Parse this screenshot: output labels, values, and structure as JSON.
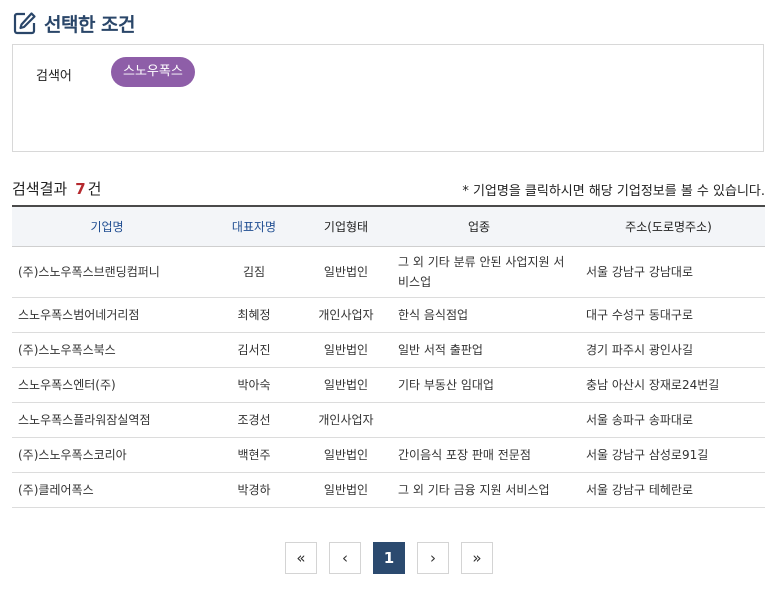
{
  "section": {
    "title": "선택한 조건",
    "icon": "edit-icon"
  },
  "condition": {
    "label": "검색어",
    "keyword": "스노우폭스"
  },
  "results": {
    "label": "검색결과",
    "count": "7",
    "unit": "건",
    "note": "* 기업명을 클릭하시면 해당 기업정보를 볼 수 있습니다."
  },
  "table": {
    "headers": {
      "company": "기업명",
      "ceo": "대표자명",
      "type": "기업형태",
      "industry": "업종",
      "address": "주소(도로명주소)"
    },
    "rows": [
      {
        "company": "(주)스노우폭스브랜딩컴퍼니",
        "ceo": "김짐",
        "type": "일반법인",
        "industry": "그 외 기타 분류 안된 사업지원 서비스업",
        "address": "서울 강남구 강남대로"
      },
      {
        "company": "스노우폭스범어네거리점",
        "ceo": "최혜정",
        "type": "개인사업자",
        "industry": "한식 음식점업",
        "address": "대구 수성구 동대구로"
      },
      {
        "company": "(주)스노우폭스북스",
        "ceo": "김서진",
        "type": "일반법인",
        "industry": "일반 서적 출판업",
        "address": "경기 파주시 광인사길"
      },
      {
        "company": "스노우폭스엔터(주)",
        "ceo": "박아숙",
        "type": "일반법인",
        "industry": "기타 부동산 임대업",
        "address": "충남 아산시 장재로24번길"
      },
      {
        "company": "스노우폭스플라워잠실역점",
        "ceo": "조경선",
        "type": "개인사업자",
        "industry": "",
        "address": "서울 송파구 송파대로"
      },
      {
        "company": "(주)스노우폭스코리아",
        "ceo": "백현주",
        "type": "일반법인",
        "industry": "간이음식 포장 판매 전문점",
        "address": "서울 강남구 삼성로91길"
      },
      {
        "company": "(주)클레어폭스",
        "ceo": "박경하",
        "type": "일반법인",
        "industry": "그 외 기타 금융 지원 서비스업",
        "address": "서울 강남구 테헤란로"
      }
    ]
  },
  "pagination": {
    "first": "«",
    "prev": "‹",
    "current": "1",
    "next": "›",
    "last": "»"
  }
}
